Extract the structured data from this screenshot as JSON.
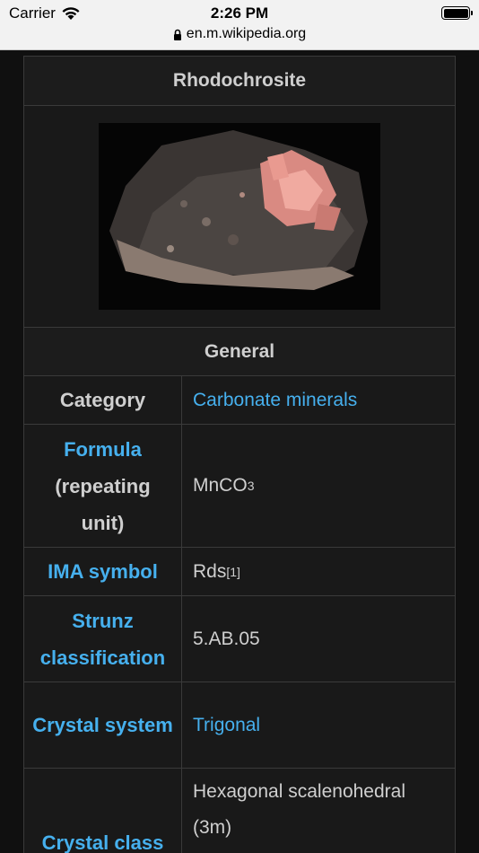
{
  "status_bar": {
    "carrier": "Carrier",
    "time": "2:26 PM",
    "url": "en.m.wikipedia.org"
  },
  "infobox": {
    "title": "Rhodochrosite",
    "image_icon": "mineral-photo",
    "section_general": "General",
    "rows": {
      "category": {
        "label": "Category",
        "value": "Carbonate minerals"
      },
      "formula": {
        "label": "Formula",
        "label_rest": "(repeating unit)",
        "value_main": "MnCO",
        "value_sub": "3"
      },
      "ima": {
        "label": "IMA symbol",
        "value": "Rds",
        "ref": "[1]"
      },
      "strunz": {
        "label": "Strunz classification",
        "value": "5.AB.05"
      },
      "crystal_system": {
        "label": "Crystal system",
        "value": "Trigonal"
      },
      "crystal_class": {
        "label": "Crystal class",
        "value": "Hexagonal scalenohedral (3m)"
      }
    }
  },
  "colors": {
    "link": "#46b0ee",
    "background": "#101010",
    "cell": "#191919",
    "border": "#3a3a3a"
  }
}
